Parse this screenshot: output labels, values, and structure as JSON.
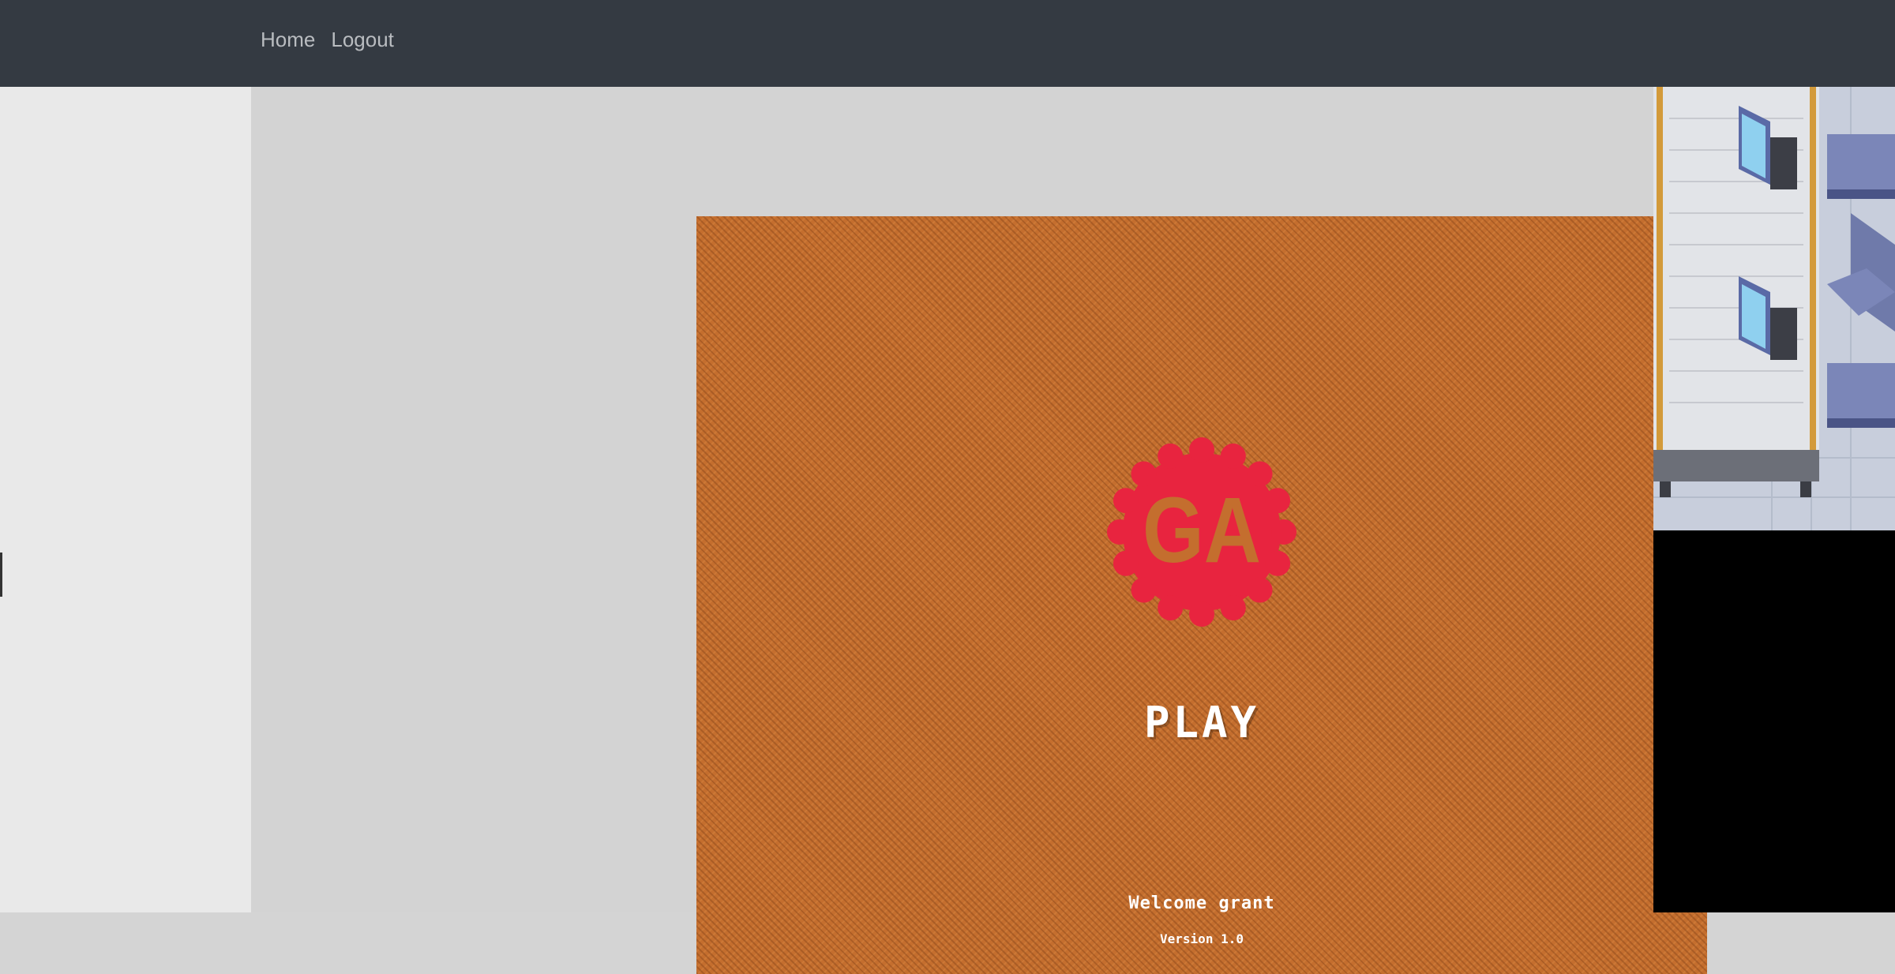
{
  "nav": {
    "items": [
      {
        "label": "Home"
      },
      {
        "label": "Logout"
      }
    ]
  },
  "game": {
    "logo_text": "GA",
    "play_label": "PLAY",
    "welcome": "Welcome grant",
    "version": "Version 1.0"
  },
  "colors": {
    "topbar": "#343a42",
    "game_background": "#c46e2e",
    "logo": "#e8243f",
    "right_panel": "#000000"
  }
}
